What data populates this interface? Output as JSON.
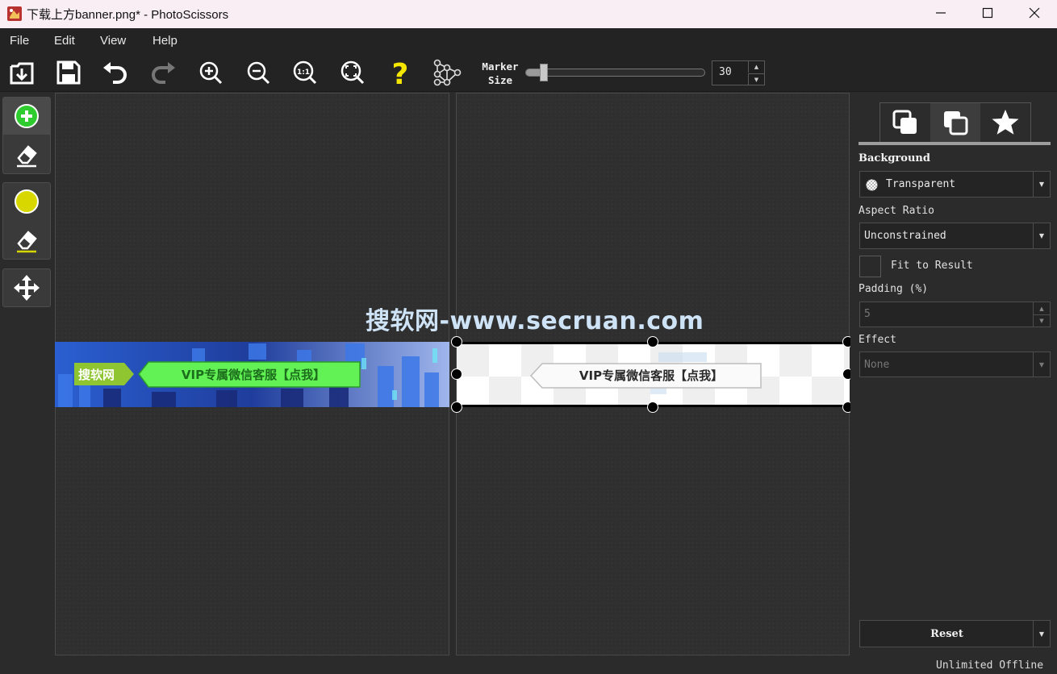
{
  "window": {
    "title": "下载上方banner.png* - PhotoScissors",
    "controls": [
      "minimize-icon",
      "maximize-icon",
      "close-icon"
    ]
  },
  "menu": {
    "items": [
      "File",
      "Edit",
      "View",
      "Help"
    ]
  },
  "toolbar": {
    "buttons": [
      "open-icon",
      "save-icon",
      "undo-icon",
      "redo-icon",
      "zoom-in-icon",
      "zoom-out-icon",
      "zoom-actual-icon",
      "zoom-fit-icon",
      "help-icon",
      "network-icon"
    ],
    "marker_label_line1": "Marker",
    "marker_label_line2": "Size",
    "marker_size_value": "30",
    "marker_size_fraction": 0.1
  },
  "left_tools": [
    "foreground-marker-icon",
    "foreground-eraser-icon",
    "background-marker-icon",
    "background-eraser-icon",
    "move-icon"
  ],
  "canvas": {
    "source_banner": {
      "logo_text": "搜软网",
      "button_text": "VIP专属微信客服【点我】"
    },
    "result_banner": {
      "button_text": "VIP专属微信客服【点我】"
    },
    "watermark": "搜软网-www.secruan.com"
  },
  "panel": {
    "tabs": [
      "background-tab-icon",
      "foreground-tab-icon",
      "effects-tab-icon"
    ],
    "background_label": "Background",
    "background_value": "Transparent",
    "aspect_ratio_label": "Aspect Ratio",
    "aspect_ratio_value": "Unconstrained",
    "fit_to_result_label": "Fit to Result",
    "fit_to_result_checked": false,
    "padding_label": "Padding (%)",
    "padding_value": "5",
    "effect_label": "Effect",
    "effect_value": "None",
    "reset_label": "Reset"
  },
  "status": {
    "license": "Unlimited Offline"
  },
  "colors": {
    "accent_green": "#2ecc2e",
    "marker_yellow": "#d8d800",
    "help_yellow": "#f5e600",
    "title_bar": "#f8eef3"
  }
}
